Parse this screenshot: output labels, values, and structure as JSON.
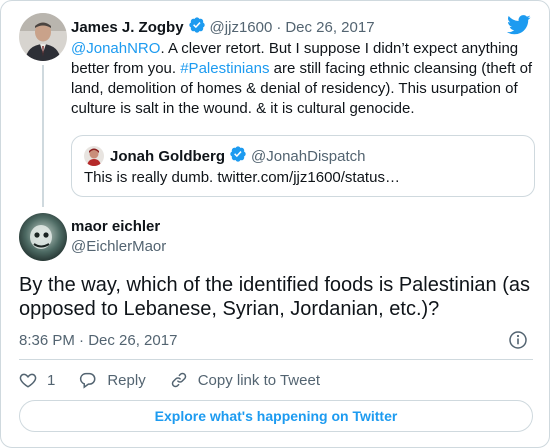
{
  "parent_tweet": {
    "author_name": "James J. Zogby",
    "handle": "@jjz1600",
    "separator": "·",
    "date": "Dec 26, 2017",
    "text_parts": [
      "@JonahNRO",
      ". A clever retort.  But I suppose I didn’t expect anything better from you. ",
      "#Palestinians",
      " are still facing ethnic cleansing (theft of land, demolition of homes & denial of residency). This usurpation of culture is salt in the wound. & it is cultural genocide."
    ]
  },
  "quoted_tweet": {
    "author_name": "Jonah Goldberg",
    "handle": "@JonahDispatch",
    "text": "This is really dumb. twitter.com/jjz1600/status…"
  },
  "main_tweet": {
    "author_name": "maor eichler",
    "handle": "@EichlerMaor",
    "text": "By the way, which of the identified foods is Palestinian (as opposed to Lebanese, Syrian, Jordanian, etc.)?",
    "timestamp": "8:36 PM · Dec 26, 2017"
  },
  "actions": {
    "like_count": "1",
    "reply_label": "Reply",
    "copy_link_label": "Copy link to Tweet"
  },
  "explore_label": "Explore what's happening on Twitter",
  "colors": {
    "accent": "#1d9bf0",
    "secondary_text": "#536471",
    "border": "#cfd9de"
  },
  "icons": [
    "twitter-bird-icon",
    "verified-badge-icon",
    "info-icon",
    "heart-icon",
    "reply-icon",
    "link-icon"
  ]
}
